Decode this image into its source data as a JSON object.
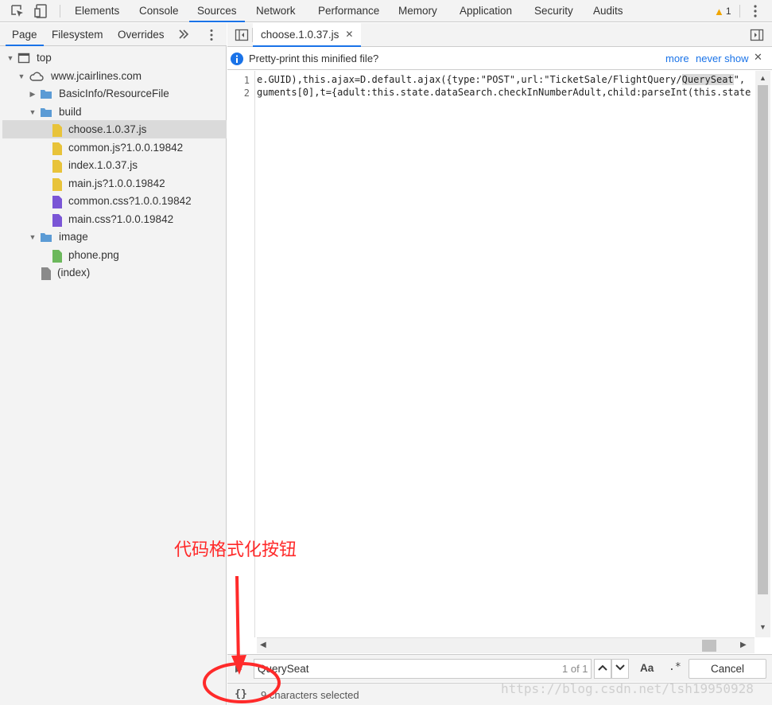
{
  "toolbar": {
    "tabs": [
      "Elements",
      "Console",
      "Sources",
      "Network",
      "Performance",
      "Memory",
      "Application",
      "Security",
      "Audits"
    ],
    "selected_tab": "Sources",
    "warning_count": "1"
  },
  "navigator": {
    "tabs": [
      "Page",
      "Filesystem",
      "Overrides"
    ],
    "selected_tab": "Page",
    "tree": [
      {
        "label": "top",
        "type": "frame",
        "depth": 0,
        "expanded": true
      },
      {
        "label": "www.jcairlines.com",
        "type": "domain",
        "depth": 1,
        "expanded": true
      },
      {
        "label": "BasicInfo/ResourceFile",
        "type": "folder",
        "depth": 2,
        "expanded": false
      },
      {
        "label": "build",
        "type": "folder",
        "depth": 2,
        "expanded": true
      },
      {
        "label": "choose.1.0.37.js",
        "type": "js",
        "depth": 3,
        "selected": true
      },
      {
        "label": "common.js?1.0.0.19842",
        "type": "js",
        "depth": 3
      },
      {
        "label": "index.1.0.37.js",
        "type": "js",
        "depth": 3
      },
      {
        "label": "main.js?1.0.0.19842",
        "type": "js",
        "depth": 3
      },
      {
        "label": "common.css?1.0.0.19842",
        "type": "css",
        "depth": 3
      },
      {
        "label": "main.css?1.0.0.19842",
        "type": "css",
        "depth": 3
      },
      {
        "label": "image",
        "type": "folder",
        "depth": 2,
        "expanded": true
      },
      {
        "label": "phone.png",
        "type": "image",
        "depth": 3
      },
      {
        "label": "(index)",
        "type": "doc",
        "depth": 2
      }
    ]
  },
  "editor": {
    "open_file": "choose.1.0.37.js",
    "infobar": {
      "message": "Pretty-print this minified file?",
      "more": "more",
      "never_show": "never show"
    },
    "lines": [
      {
        "number": "1",
        "before": "e.GUID),this.ajax=D.default.ajax({type:\"POST\",url:\"TicketSale/FlightQuery/",
        "highlight": "QuerySeat",
        "after": "\","
      },
      {
        "number": "2",
        "before": "guments[0],t={adult:this.state.dataSearch.checkInNumberAdult,child:parseInt(this.state",
        "highlight": "",
        "after": ""
      }
    ]
  },
  "search": {
    "query": "QuerySeat",
    "match_count": "1 of 1",
    "match_case_label": "Aa",
    "regex_label": ".*",
    "cancel_label": "Cancel"
  },
  "status": {
    "pretty_print_label": "{}",
    "selection_text": "9 characters selected"
  },
  "annotation": {
    "text": "代码格式化按钮"
  },
  "watermark": "https://blog.csdn.net/lsh19950928",
  "colors": {
    "accent": "#1a73e8",
    "annotation": "#ff2a2a",
    "js_file": "#e8c33a",
    "css_file": "#7a55d6",
    "image_file": "#6cb85c",
    "folder": "#5b9bd5"
  }
}
